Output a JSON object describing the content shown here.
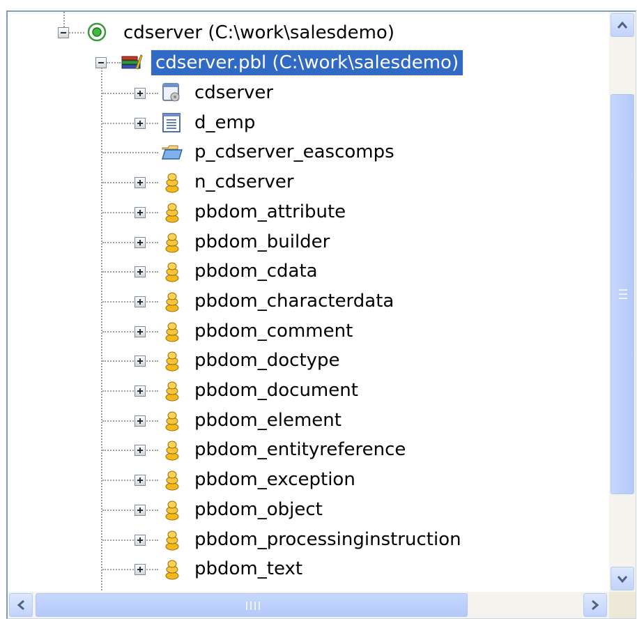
{
  "tree": {
    "root": {
      "label": "cdserver (C:\\work\\salesdemo)",
      "icon": "target-icon",
      "expanded": true
    },
    "library": {
      "label": "cdserver.pbl (C:\\work\\salesdemo)",
      "icon": "library-icon",
      "expanded": true,
      "selected": true
    },
    "objects": [
      {
        "label": "cdserver",
        "icon": "application-icon",
        "expandable": true
      },
      {
        "label": "d_emp",
        "icon": "datawindow-icon",
        "expandable": true
      },
      {
        "label": "p_cdserver_eascomps",
        "icon": "folder-open-icon",
        "expandable": false
      },
      {
        "label": "n_cdserver",
        "icon": "user-object-icon",
        "expandable": true
      },
      {
        "label": "pbdom_attribute",
        "icon": "user-object-icon",
        "expandable": true
      },
      {
        "label": "pbdom_builder",
        "icon": "user-object-icon",
        "expandable": true
      },
      {
        "label": "pbdom_cdata",
        "icon": "user-object-icon",
        "expandable": true
      },
      {
        "label": "pbdom_characterdata",
        "icon": "user-object-icon",
        "expandable": true
      },
      {
        "label": "pbdom_comment",
        "icon": "user-object-icon",
        "expandable": true
      },
      {
        "label": "pbdom_doctype",
        "icon": "user-object-icon",
        "expandable": true
      },
      {
        "label": "pbdom_document",
        "icon": "user-object-icon",
        "expandable": true
      },
      {
        "label": "pbdom_element",
        "icon": "user-object-icon",
        "expandable": true
      },
      {
        "label": "pbdom_entityreference",
        "icon": "user-object-icon",
        "expandable": true
      },
      {
        "label": "pbdom_exception",
        "icon": "user-object-icon",
        "expandable": true
      },
      {
        "label": "pbdom_object",
        "icon": "user-object-icon",
        "expandable": true
      },
      {
        "label": "pbdom_processinginstruction",
        "icon": "user-object-icon",
        "expandable": true
      },
      {
        "label": "pbdom_text",
        "icon": "user-object-icon",
        "expandable": true
      }
    ]
  },
  "scrollbars": {
    "vertical": {
      "up_icon": "chevron-up-icon",
      "down_icon": "chevron-down-icon",
      "position": 0.1
    },
    "horizontal": {
      "left_icon": "chevron-left-icon",
      "right_icon": "chevron-right-icon",
      "position": 0.0
    }
  },
  "colors": {
    "selection": "#316ac5",
    "scroll_accent": "#c1d3fb",
    "border": "#7f9db9"
  }
}
